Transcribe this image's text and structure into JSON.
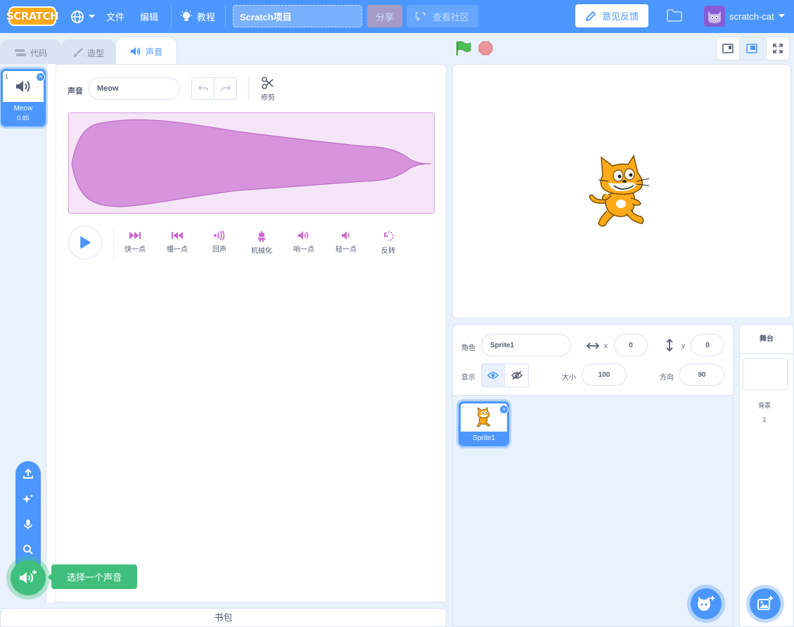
{
  "menubar": {
    "logo": "SCRATCH",
    "file": "文件",
    "edit": "编辑",
    "tutorials": "教程",
    "project_title": "Scratch项目",
    "share": "分享",
    "see_community": "查看社区",
    "feedback": "意见反馈",
    "username": "scratch-cat"
  },
  "tabs": {
    "code": "代码",
    "costumes": "造型",
    "sounds": "声音"
  },
  "sound_list": [
    {
      "index": "1",
      "name": "Meow",
      "duration": "0.85"
    }
  ],
  "sound_editor": {
    "name_label": "声音",
    "name_value": "Meow",
    "trim_label": "修剪",
    "effects": [
      {
        "label": "快一点",
        "icon": "faster-icon"
      },
      {
        "label": "慢一点",
        "icon": "slower-icon"
      },
      {
        "label": "回声",
        "icon": "echo-icon"
      },
      {
        "label": "机械化",
        "icon": "robot-icon"
      },
      {
        "label": "响一点",
        "icon": "louder-icon"
      },
      {
        "label": "轻一点",
        "icon": "softer-icon"
      },
      {
        "label": "反转",
        "icon": "reverse-icon"
      }
    ]
  },
  "add_sound_tooltip": "选择一个声音",
  "backpack": "书包",
  "sprite_info": {
    "sprite_label": "角色",
    "sprite_name": "Sprite1",
    "x_label": "x",
    "x_value": "0",
    "y_label": "y",
    "y_value": "0",
    "show_label": "显示",
    "size_label": "大小",
    "size_value": "100",
    "direction_label": "方向",
    "direction_value": "90"
  },
  "sprites": [
    {
      "name": "Sprite1"
    }
  ],
  "stage_pane": {
    "header": "舞台",
    "backdrops_label": "背景",
    "backdrops_count": "1"
  },
  "colors": {
    "menubar": "#4c97ff",
    "sound_accent": "#cf63cf",
    "waveform_fill": "#d694dc",
    "add_green": "#40bf7c",
    "cat_orange": "#ffab19"
  }
}
